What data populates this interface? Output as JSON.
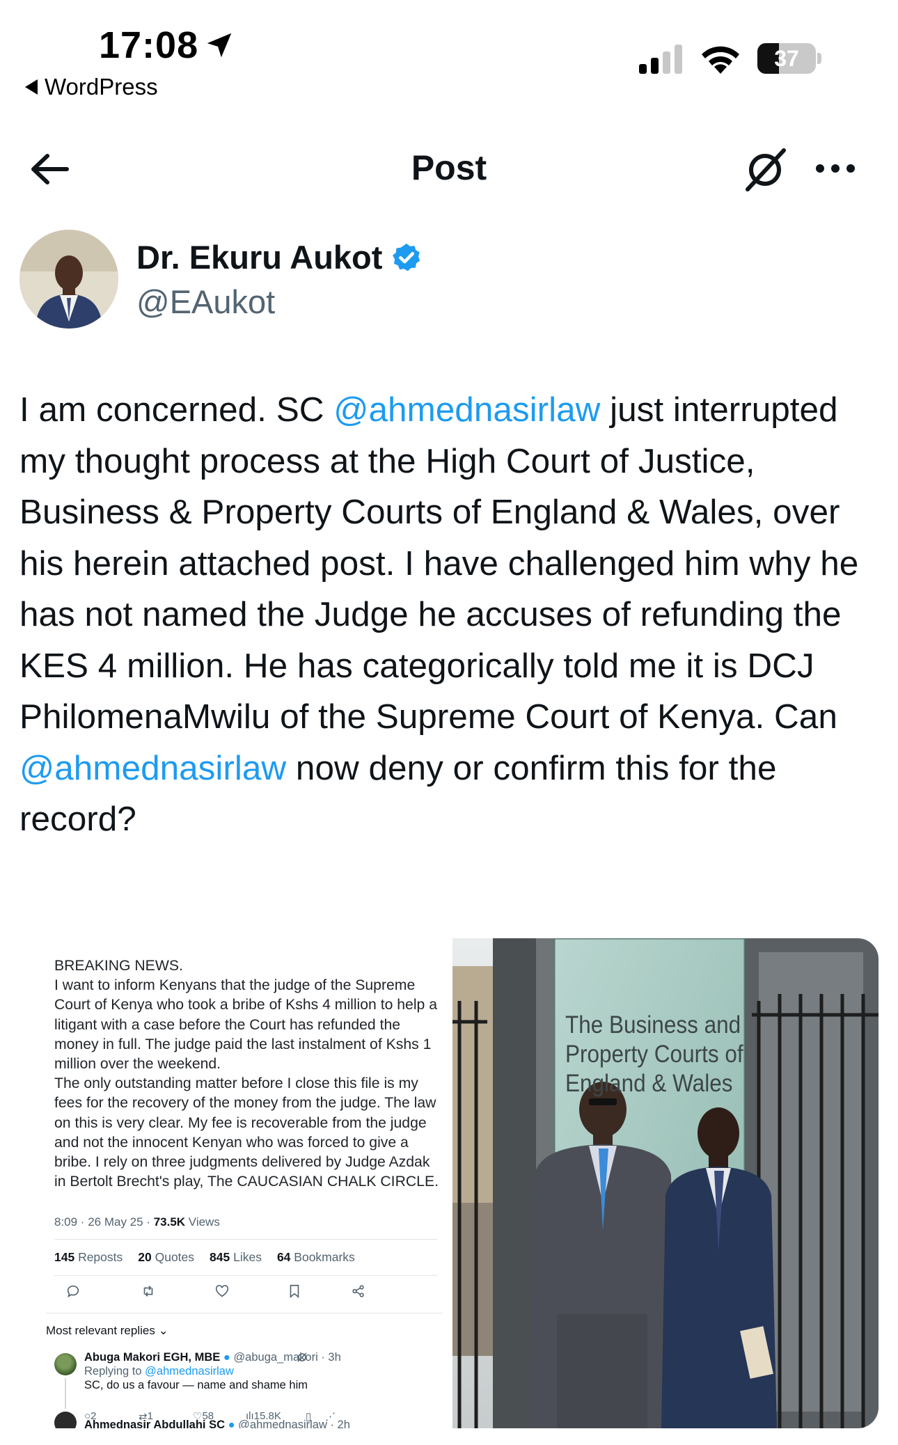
{
  "status_bar": {
    "time": "17:08",
    "back_app": "WordPress",
    "battery": "37",
    "battery_level": 0.37
  },
  "header": {
    "title": "Post"
  },
  "author": {
    "name": "Dr. Ekuru Aukot",
    "handle": "@EAukot"
  },
  "post": {
    "seg1": "I am concerned. SC ",
    "mention1": "@ahmednasirlaw",
    "seg2": " just interrupted my thought process at the High Court of Justice, Business & Property Courts of England & Wales, over his herein attached post. I have challenged him why he has not named the Judge he accuses of refunding the KES 4 million. He has categorically told me it is DCJ PhilomenaMwilu of the Supreme Court of Kenya. Can ",
    "mention2": "@ahmednasirlaw",
    "seg3": " now deny or confirm this for the record?"
  },
  "embedded_post": {
    "text": "BREAKING NEWS.\nI want to inform Kenyans that the judge of the Supreme Court of Kenya who took a bribe of Kshs 4 million to help a litigant with a case before the Court has refunded the money in full. The judge paid the last instalment of Kshs 1 million over the weekend.\nThe only outstanding matter before I close this file is my fees for the recovery of the money from the judge. The law on this is very clear. My fee is recoverable from the judge and not the innocent Kenyan who was forced to give a bribe. I rely on three judgments delivered by Judge Azdak in Bertolt Brecht's play, The CAUCASIAN CHALK CIRCLE.",
    "timestamp": "8:09 · 26 May 25 · ",
    "views_count": "73.5K",
    "views_label": " Views",
    "reposts_count": "145",
    "reposts_label": " Reposts",
    "quotes_count": "20",
    "quotes_label": " Quotes",
    "likes_count": "845",
    "likes_label": " Likes",
    "bookmarks_count": "64",
    "bookmarks_label": " Bookmarks",
    "relevant_label": "Most relevant replies ⌄",
    "reply1": {
      "name": "Abuga Makori EGH, MBE",
      "handle": "@abuga_makori · 3h",
      "replying_prefix": "Replying to ",
      "replying_to": "@ahmednasirlaw",
      "text": "SC, do us a favour — name and shame him",
      "replies": "2",
      "reposts": "1",
      "likes": "58",
      "views": "15.8K"
    },
    "reply2": {
      "name": "Ahmednasir Abdullahi SC",
      "handle": "@ahmednasirlaw · 2h"
    }
  },
  "photo": {
    "sign_line1": "The Business and",
    "sign_line2": "Property Courts of",
    "sign_line3": "England & Wales"
  },
  "colors": {
    "accent": "#1d9bf0",
    "text": "#0f1419",
    "secondary": "#536471"
  }
}
